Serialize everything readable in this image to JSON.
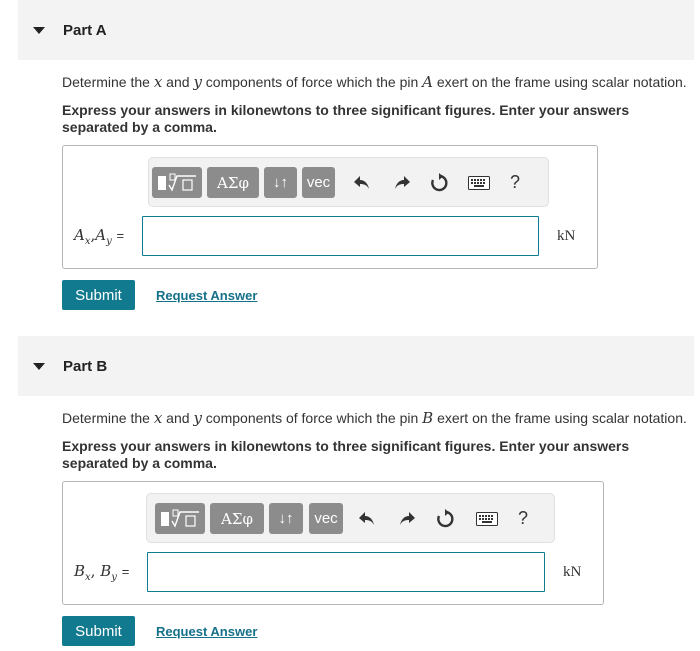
{
  "part_a": {
    "title": "Part A",
    "question": {
      "pre": "Determine the ",
      "var1": "x",
      "mid1": " and ",
      "var2": "y",
      "mid2": " components of force which the pin ",
      "pin": "A",
      "post": " exert on the frame using scalar notation."
    },
    "instruction": "Express your answers in kilonewtons to three significant figures. Enter your answers separated by a comma.",
    "label": {
      "v1": "A",
      "s1": "x",
      "sep": ",",
      "v2": "A",
      "s2": "y",
      "eq": "="
    },
    "input_value": "",
    "unit": "kN",
    "submit_label": "Submit",
    "request_label": "Request Answer"
  },
  "part_b": {
    "title": "Part B",
    "question": {
      "pre": "Determine the ",
      "var1": "x",
      "mid1": " and ",
      "var2": "y",
      "mid2": " components of force which the pin ",
      "pin": "B",
      "post": " exert on the frame using scalar notation."
    },
    "instruction": "Express your answers in kilonewtons to three significant figures. Enter your answers separated by a comma.",
    "label": {
      "v1": "B",
      "s1": "x",
      "sep": ", ",
      "v2": "B",
      "s2": "y",
      "eq": "="
    },
    "input_value": "",
    "unit": "kN",
    "submit_label": "Submit",
    "request_label": "Request Answer"
  },
  "toolbar": {
    "greek_label": "ΑΣφ",
    "arrows_label": "↓↑",
    "vec_label": "vec",
    "help_label": "?",
    "icons": [
      "templates-icon",
      "greek-icon",
      "subscript-superscript-icon",
      "vector-icon",
      "undo-icon",
      "redo-icon",
      "reset-icon",
      "keyboard-icon",
      "help-icon"
    ]
  }
}
